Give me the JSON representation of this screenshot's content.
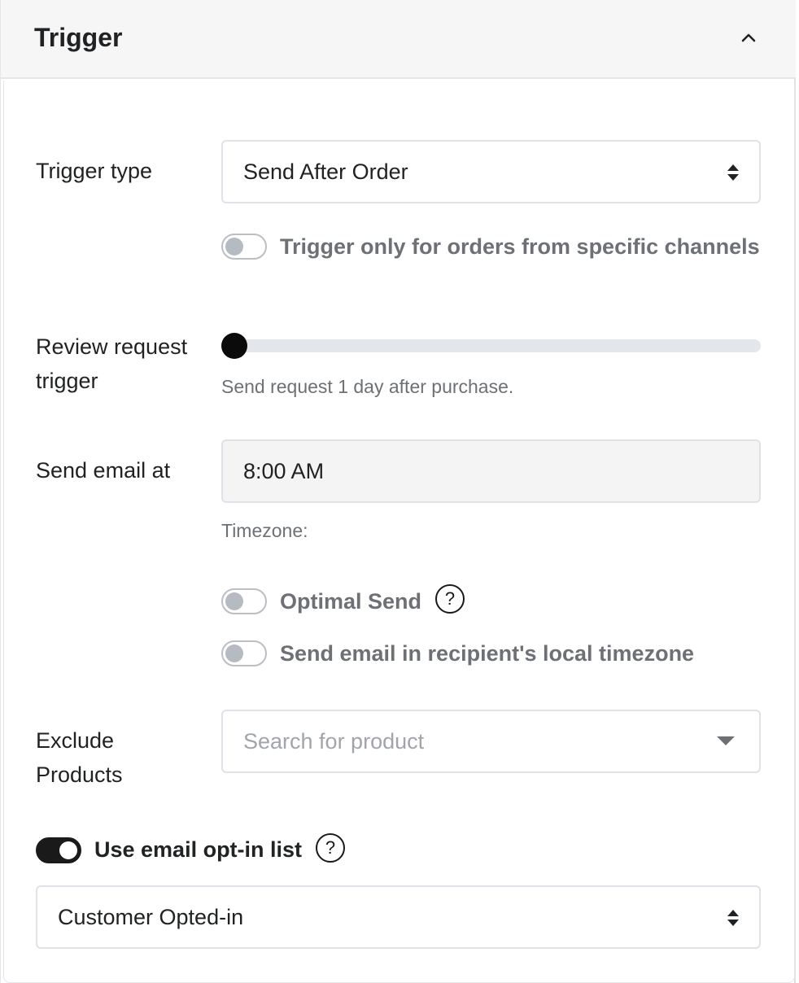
{
  "section": {
    "title": "Trigger",
    "collapse_icon": "chevron-up-icon"
  },
  "trigger_type": {
    "label": "Trigger type",
    "selected": "Send After Order"
  },
  "channels_toggle": {
    "label": "Trigger only for orders from specific channels",
    "on": false
  },
  "review_trigger": {
    "label_line1": "Review request",
    "label_line2": "trigger",
    "slider_value_days": 1,
    "help": "Send request 1 day after purchase."
  },
  "send_email": {
    "label": "Send email at",
    "value": "8:00 AM",
    "timezone_label": "Timezone:"
  },
  "optimal_send": {
    "label": "Optimal Send",
    "on": false,
    "help_icon": "?"
  },
  "local_timezone": {
    "label": "Send email in recipient's local timezone",
    "on": false
  },
  "exclude_products": {
    "label_line1": "Exclude",
    "label_line2": "Products",
    "placeholder": "Search for product"
  },
  "opt_in": {
    "label": "Use email opt-in list",
    "on": true,
    "help_icon": "?",
    "selected": "Customer Opted-in"
  }
}
